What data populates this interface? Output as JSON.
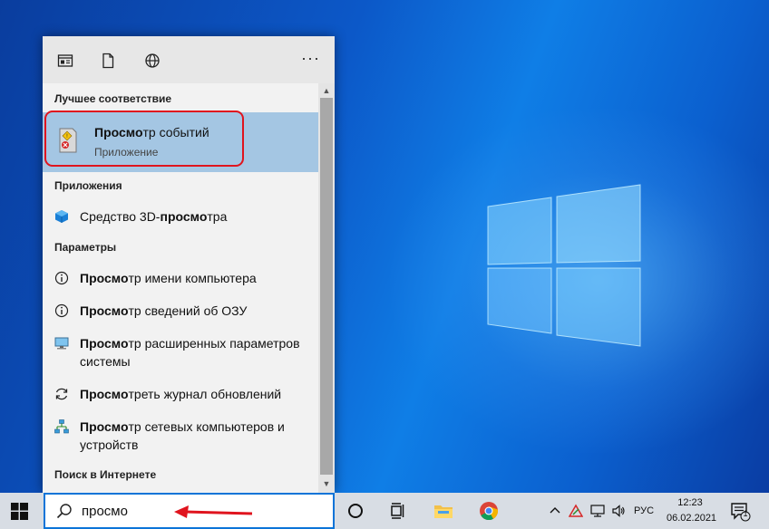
{
  "toolbar": {
    "icons": [
      "apps-filter-icon",
      "documents-filter-icon",
      "web-filter-icon"
    ],
    "more_label": "···"
  },
  "best_match": {
    "section_label": "Лучшее соответствие",
    "title_bold": "Просмо",
    "title_rest": "тр событий",
    "subtitle": "Приложение"
  },
  "apps": {
    "section_label": "Приложения",
    "items": [
      {
        "pre": "Средство 3D-",
        "bold": "просмо",
        "post": "тра"
      }
    ]
  },
  "settings": {
    "section_label": "Параметры",
    "items": [
      {
        "bold": "Просмо",
        "rest": "тр имени компьютера"
      },
      {
        "bold": "Просмо",
        "rest": "тр сведений об ОЗУ"
      },
      {
        "bold": "Просмо",
        "rest": "тр расширенных параметров системы"
      },
      {
        "bold": "Просмо",
        "rest": "треть журнал обновлений"
      },
      {
        "bold": "Просмо",
        "rest": "тр сетевых компьютеров и устройств"
      }
    ]
  },
  "web": {
    "section_label": "Поиск в Интернете"
  },
  "search": {
    "value": "просмо"
  },
  "taskbar": {
    "language": "РУС",
    "time": "12:23",
    "date": "06.02.2021",
    "notification_count": "1"
  },
  "colors": {
    "highlight": "#a4c6e3",
    "annotation_red": "#e0141e",
    "accent": "#0b74d8"
  }
}
